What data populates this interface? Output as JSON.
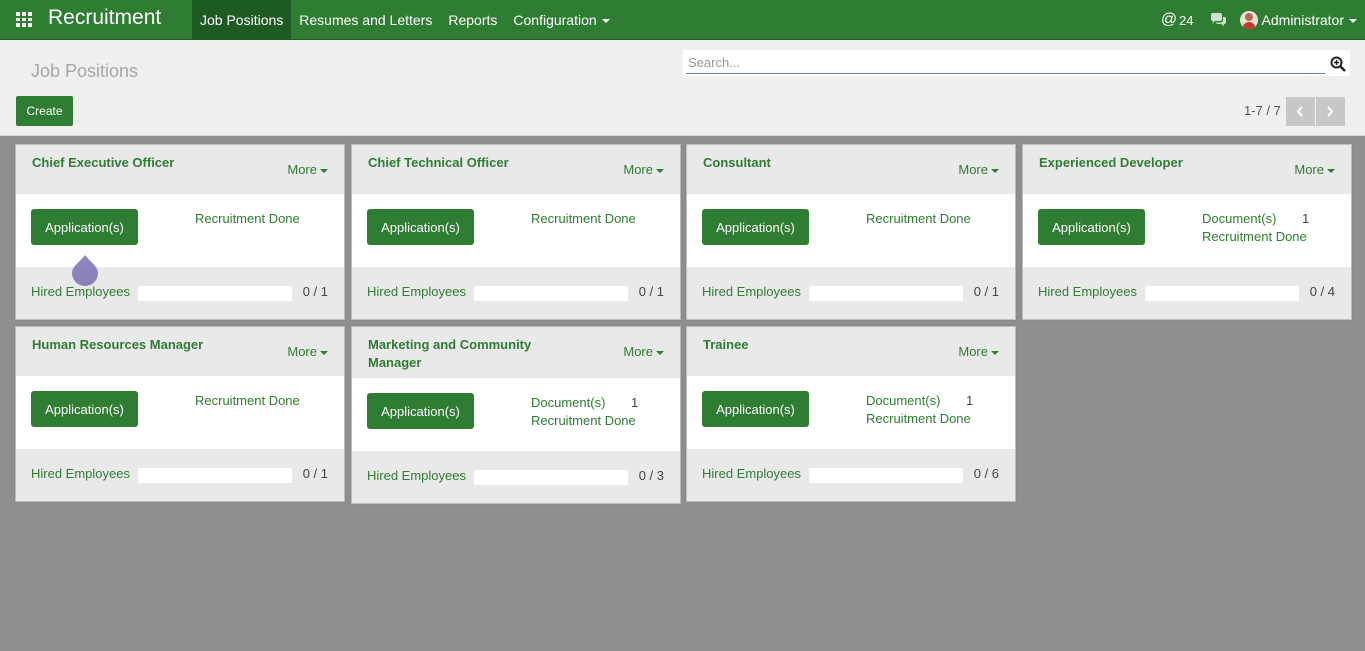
{
  "navbar": {
    "brand": "Recruitment",
    "menu": [
      {
        "label": "Job Positions",
        "active": true,
        "dropdown": false
      },
      {
        "label": "Resumes and Letters",
        "active": false,
        "dropdown": false
      },
      {
        "label": "Reports",
        "active": false,
        "dropdown": false
      },
      {
        "label": "Configuration",
        "active": false,
        "dropdown": true
      }
    ],
    "messages_count": "24",
    "user": "Administrator"
  },
  "control": {
    "breadcrumb": "Job Positions",
    "search_placeholder": "Search...",
    "create_label": "Create",
    "pager": "1-7 / 7"
  },
  "labels": {
    "more": "More",
    "applications": "Application(s)",
    "documents": "Document(s)",
    "recruitment_done": "Recruitment Done",
    "hired_employees": "Hired Employees"
  },
  "jobs": [
    {
      "title": "Chief Executive Officer",
      "documents": null,
      "hired": "0 / 1",
      "hired_fraction": 0
    },
    {
      "title": "Chief Technical Officer",
      "documents": null,
      "hired": "0 / 1",
      "hired_fraction": 0
    },
    {
      "title": "Consultant",
      "documents": null,
      "hired": "0 / 1",
      "hired_fraction": 0
    },
    {
      "title": "Experienced Developer",
      "documents": "1",
      "hired": "0 / 4",
      "hired_fraction": 0
    },
    {
      "title": "Human Resources Manager",
      "documents": null,
      "hired": "0 / 1",
      "hired_fraction": 0
    },
    {
      "title": "Marketing and Community Manager",
      "documents": "1",
      "hired": "0 / 3",
      "hired_fraction": 0
    },
    {
      "title": "Trainee",
      "documents": "1",
      "hired": "0 / 6",
      "hired_fraction": 0
    }
  ],
  "colors": {
    "primary": "#2e7d32",
    "background": "#8f8f8f",
    "control_panel": "#f0eeee"
  }
}
